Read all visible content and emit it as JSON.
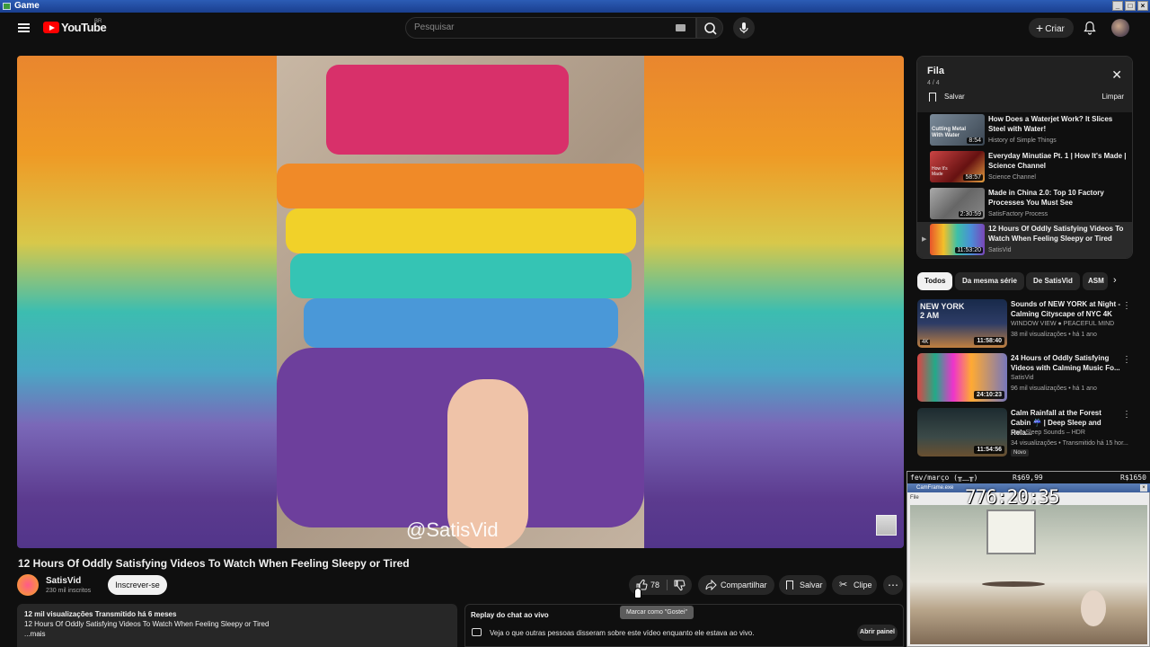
{
  "window": {
    "title": "Game"
  },
  "header": {
    "logo_text": "YouTube",
    "country_code": "BR",
    "search_placeholder": "Pesquisar",
    "create_label": "Criar"
  },
  "video": {
    "watermark": "@SatisVid",
    "title": "12 Hours Of Oddly Satisfying Videos To Watch When Feeling Sleepy or Tired",
    "channel": "SatisVid",
    "subscribers": "230 mil inscritos",
    "subscribe_label": "Inscrever-se",
    "likes": "78",
    "share_label": "Compartilhar",
    "save_label": "Salvar",
    "clip_label": "Clipe",
    "tooltip": "Marcar como \"Gostei\""
  },
  "description": {
    "meta": "12 mil visualizações  Transmitido há 6 meses",
    "text": "12 Hours Of Oddly Satisfying Videos To Watch When Feeling Sleepy or Tired",
    "more": "...mais"
  },
  "chat": {
    "title": "Replay do chat ao vivo",
    "subtitle": "Veja o que outras pessoas disseram sobre este vídeo enquanto ele estava ao vivo.",
    "button": "Abrir painel"
  },
  "queue": {
    "title": "Fila",
    "count": "4 / 4",
    "save_label": "Salvar",
    "clear_label": "Limpar",
    "items": [
      {
        "title": "How Does a Waterjet Work? It Slices Steel with Water!",
        "channel": "History of Simple Things",
        "duration": "8:54",
        "thumb_text": "Cutting Metal With Water"
      },
      {
        "title": "Everyday Minutiae Pt. 1 | How It's Made | Science Channel",
        "channel": "Science Channel",
        "duration": "58:57",
        "thumb_text": "How It's Made"
      },
      {
        "title": "Made in China 2.0: Top 10 Factory Processes You Must See",
        "channel": "SatisFactory Process",
        "duration": "2:30:59"
      },
      {
        "title": "12 Hours Of Oddly Satisfying Videos To Watch When Feeling Sleepy or Tired",
        "channel": "SatisVid",
        "duration": "11:53:20"
      }
    ]
  },
  "chips": [
    "Todos",
    "Da mesma série",
    "De SatisVid",
    "ASM"
  ],
  "recommendations": [
    {
      "title": "Sounds of NEW YORK at Night - Calming Cityscape of NYC 4K",
      "channel": "WINDOW VIEW ● PEACEFUL MIND",
      "views": "38 mil visualizações • há 1 ano",
      "duration": "11:58:40",
      "thumb_text": "NEW YORK 2 AM",
      "badge": "4K"
    },
    {
      "title": "24 Hours of Oddly Satisfying Videos with Calming Music Fo...",
      "channel": "SatisVid",
      "views": "96 mil visualizações • há 1 ano",
      "duration": "24:10:23"
    },
    {
      "title": "Calm Rainfall at the Forest Cabin ☔ | Deep Sleep and Rela...",
      "channel": "Rain Sleep Sounds – HDR",
      "views": "34 visualizações • Transmitido há 15 hor...",
      "duration": "11:54:56",
      "new_badge": "Novo"
    }
  ],
  "overlay": {
    "label": "fev/março (╥﹏╥)",
    "price1": "R$69,99",
    "price2": "R$1650",
    "cam_title": "CamFrame.exe",
    "timer": "776:20:35",
    "file_label": "File"
  }
}
